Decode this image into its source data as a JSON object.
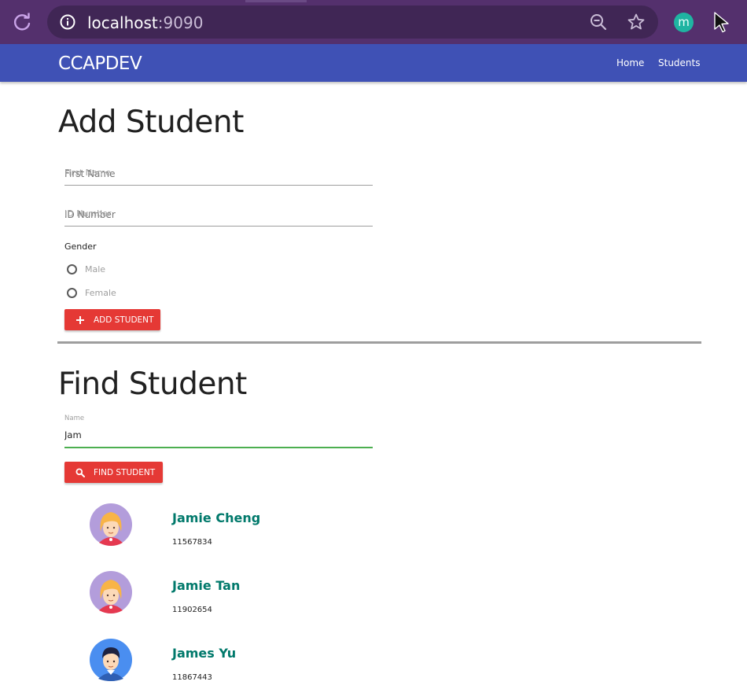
{
  "browser": {
    "url_host": "localhost",
    "url_port": ":9090",
    "profile_initial": "m",
    "icons": [
      "reload-icon",
      "info-icon",
      "zoom-out-icon",
      "bookmark-star-icon",
      "profile-avatar",
      "cursor-icon"
    ]
  },
  "navbar": {
    "brand": "CCAPDEV",
    "links": [
      "Home",
      "Students"
    ],
    "color": "#3f51b5"
  },
  "add_student": {
    "title": "Add Student",
    "first_name_placeholder": "First Name",
    "id_number_placeholder": "ID Number",
    "gender_label": "Gender",
    "gender_options": [
      "Male",
      "Female"
    ],
    "button_label": "ADD STUDENT"
  },
  "find_student": {
    "title": "Find Student",
    "name_label": "Name",
    "name_value": "Jam",
    "button_label": "FIND STUDENT"
  },
  "results": [
    {
      "name": "Jamie Cheng",
      "id": "11567834",
      "avatar": "female-avatar"
    },
    {
      "name": "Jamie Tan",
      "id": "11902654",
      "avatar": "female-avatar"
    },
    {
      "name": "James Yu",
      "id": "11867443",
      "avatar": "male-avatar"
    }
  ],
  "colors": {
    "accent_button": "#e53935",
    "result_name": "#00796b",
    "focused_input": "#4caf50"
  }
}
